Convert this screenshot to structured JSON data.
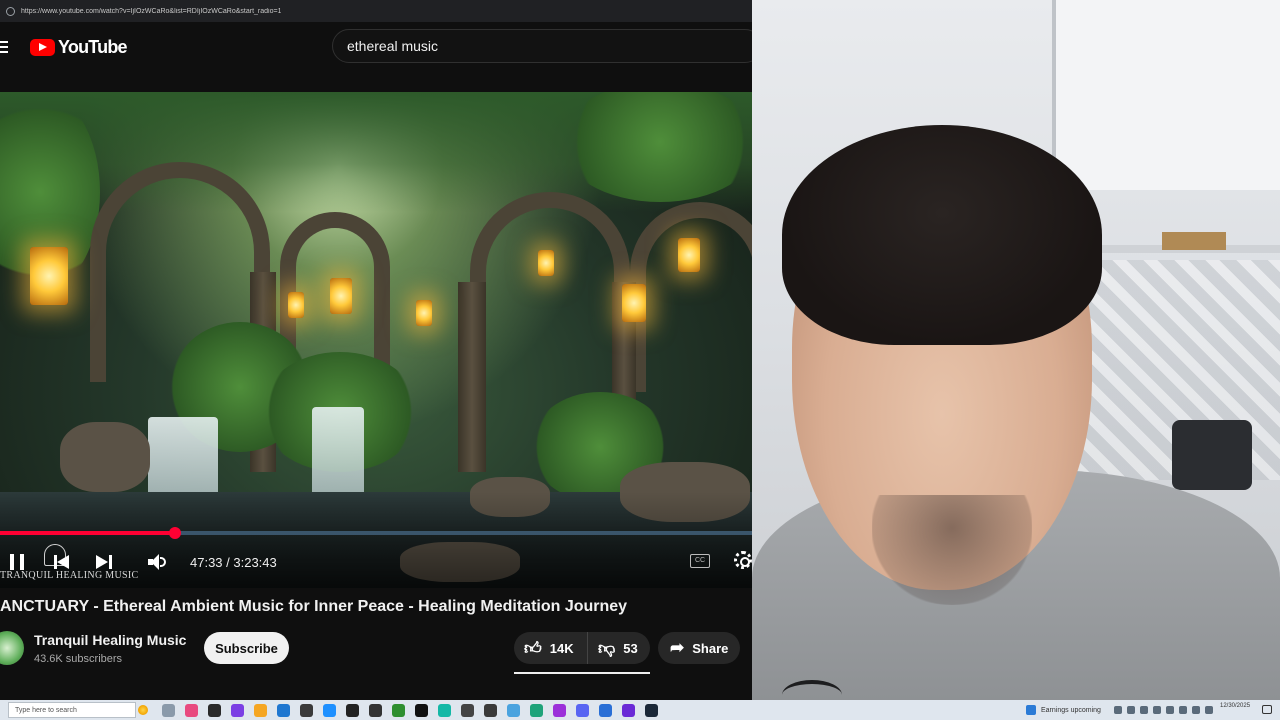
{
  "browser": {
    "url": "https://www.youtube.com/watch?v=IjIOzWCaRo&list=RDIjIOzWCaRo&start_radio=1"
  },
  "header": {
    "logo_text": "YouTube",
    "search_value": "ethereal music"
  },
  "player": {
    "current_time": "47:33",
    "duration": "3:23:43",
    "time_display": "47:33 / 3:23:43",
    "progress_fraction": 0.233,
    "watermark_text": "TRANQUIL HEALING MUSIC"
  },
  "video": {
    "title": "ANCTUARY - Ethereal Ambient Music for Inner Peace - Healing Meditation Journey",
    "channel_name": "Tranquil Healing Music",
    "subscribers": "43.6K subscribers",
    "subscribe_label": "Subscribe",
    "likes": "14K",
    "dislikes": "53",
    "share_label": "Share"
  },
  "taskbar": {
    "search_placeholder": "Type here to search",
    "widget_text": "Earnings upcoming",
    "date": "12/30/2025"
  },
  "colors": {
    "youtube_red": "#ff0000",
    "progress_red": "#ff0033",
    "background": "#0f0f0f"
  },
  "icons": [
    "menu-icon",
    "youtube-logo-icon",
    "pause-icon",
    "previous-icon",
    "next-icon",
    "volume-icon",
    "captions-icon",
    "settings-gear-icon",
    "like-thumb-icon",
    "dislike-thumb-icon",
    "share-arrow-icon"
  ]
}
